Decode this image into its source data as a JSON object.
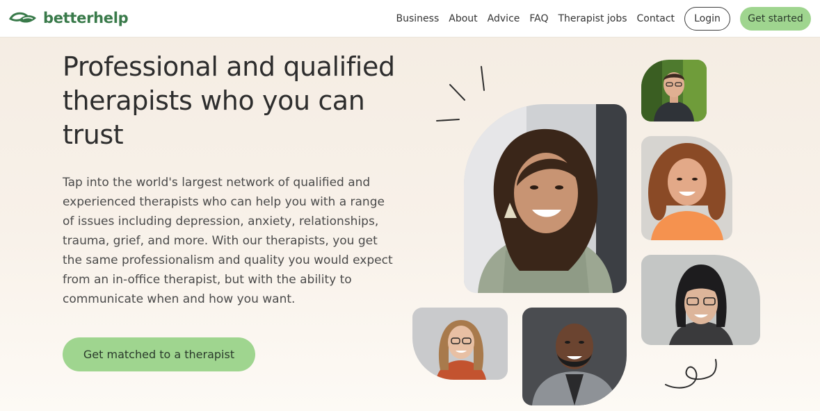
{
  "header": {
    "logo_text": "betterhelp",
    "nav": [
      "Business",
      "About",
      "Advice",
      "FAQ",
      "Therapist jobs",
      "Contact"
    ],
    "login_label": "Login",
    "get_started_label": "Get started"
  },
  "hero": {
    "title": "Professional and qualified therapists who you can trust",
    "body": "Tap into the world's largest network of qualified and experienced therapists who can help you with a range of issues including depression, anxiety, relationships, trauma, grief, and more. With our therapists, you get the same professionalism and quality you would expect from an in-office therapist, but with the ability to communicate when and how you want.",
    "cta_label": "Get matched to a therapist"
  },
  "colors": {
    "brand_green": "#397a4a",
    "button_green": "#9fd58f",
    "background": "#f4ece2"
  }
}
